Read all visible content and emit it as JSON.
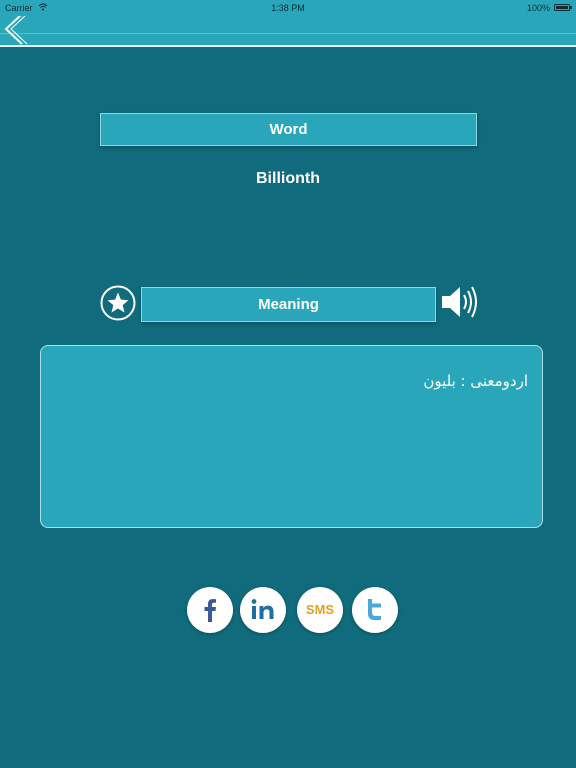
{
  "status_bar": {
    "carrier": "Carrier",
    "time": "1:38 PM",
    "battery": "100%"
  },
  "nav": {
    "back_icon": "chevron-left-icon"
  },
  "word_section": {
    "label": "Word",
    "value": "Billionth"
  },
  "meaning_section": {
    "label": "Meaning",
    "favorite_icon": "star-icon",
    "speak_icon": "speaker-icon",
    "text": "اردومعنی : بلیون"
  },
  "share": {
    "facebook_icon": "facebook-icon",
    "linkedin_icon": "linkedin-icon",
    "sms_label": "SMS",
    "twitter_icon": "twitter-icon"
  },
  "colors": {
    "background": "#106b7c",
    "bar": "#2aa6bb",
    "facebook": "#3b5998",
    "linkedin": "#1d6fa5",
    "sms": "#e2a11f",
    "twitter": "#4aa8dc"
  }
}
